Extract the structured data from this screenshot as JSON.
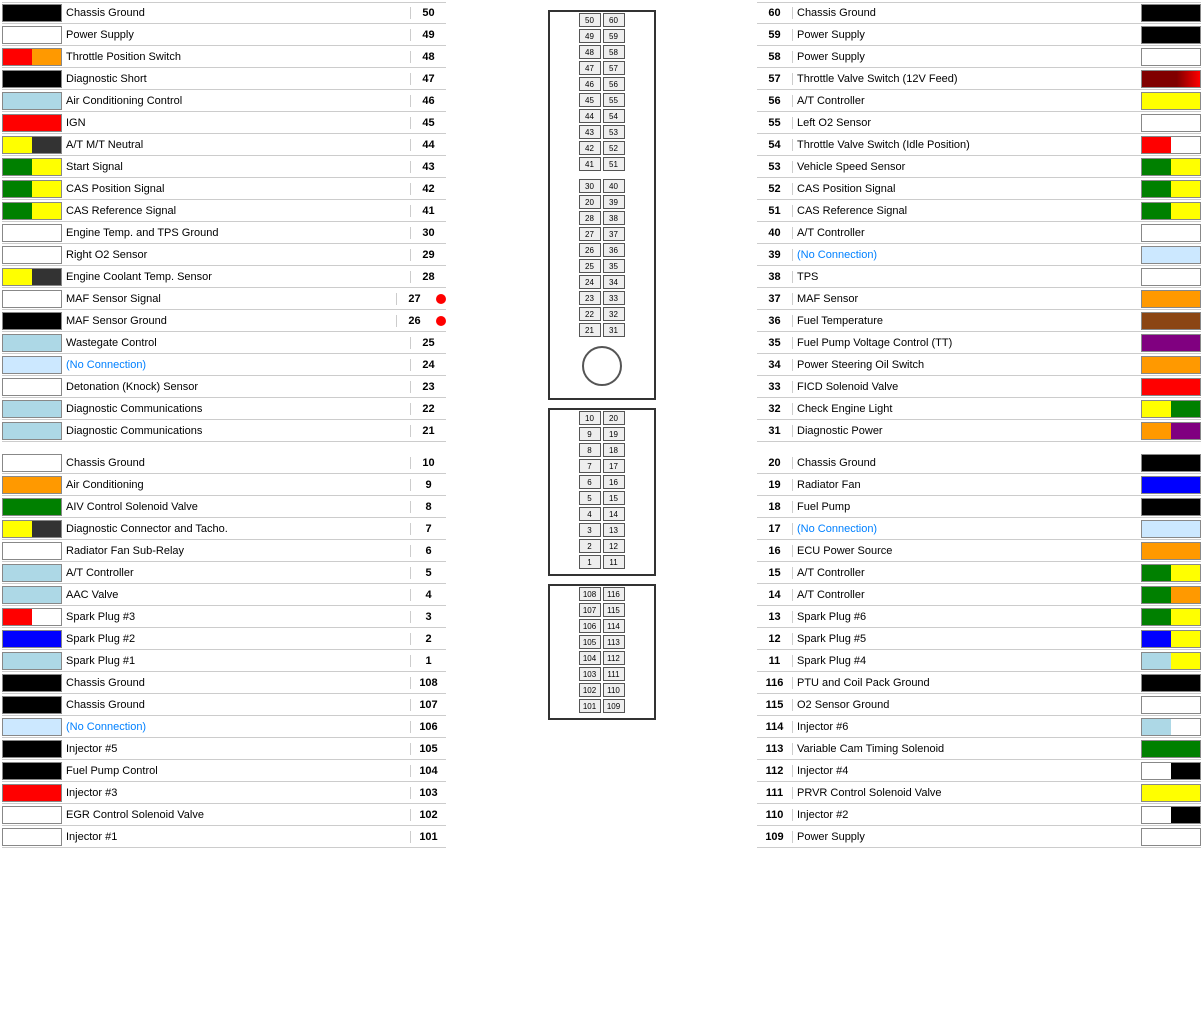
{
  "left_pins": [
    {
      "num": 50,
      "label": "Chassis Ground",
      "color": "#000"
    },
    {
      "num": 49,
      "label": "Power Supply",
      "color": "#fff"
    },
    {
      "num": 48,
      "label": "Throttle Position Switch",
      "color": "linear-gradient(to right, #f00 50%, #f90 50%)"
    },
    {
      "num": 47,
      "label": "Diagnostic Short",
      "color": "#000"
    },
    {
      "num": 46,
      "label": "Air Conditioning Control",
      "color": "#add8e6"
    },
    {
      "num": 45,
      "label": "IGN",
      "color": "#f00"
    },
    {
      "num": 44,
      "label": "A/T M/T Neutral",
      "color": "linear-gradient(to right, #ff0 50%, #333 50%)"
    },
    {
      "num": 43,
      "label": "Start Signal",
      "color": "linear-gradient(to right, #008000 50%, #ff0 50%)"
    },
    {
      "num": 42,
      "label": "CAS Position Signal",
      "color": "linear-gradient(to right, #008000 50%, #ff0 50%)"
    },
    {
      "num": 41,
      "label": "CAS Reference Signal",
      "color": "linear-gradient(to right, #008000 50%, #ff0 50%)"
    },
    {
      "num": 30,
      "label": "Engine Temp. and TPS Ground",
      "color": "#fff"
    },
    {
      "num": 29,
      "label": "Right O2 Sensor",
      "color": "#fff"
    },
    {
      "num": 28,
      "label": "Engine Coolant Temp. Sensor",
      "color": "linear-gradient(to right, #ff0 50%, #333 50%)"
    },
    {
      "num": 27,
      "label": "MAF Sensor Signal",
      "color": "#fff",
      "dot": true
    },
    {
      "num": 26,
      "label": "MAF Sensor Ground",
      "color": "#000",
      "dot": true
    },
    {
      "num": 25,
      "label": "Wastegate Control",
      "color": "#add8e6"
    },
    {
      "num": 24,
      "label": "(No Connection)",
      "color": "#cce8ff",
      "noconn": true
    },
    {
      "num": 23,
      "label": "Detonation (Knock) Sensor",
      "color": "#fff"
    },
    {
      "num": 22,
      "label": "Diagnostic Communications",
      "color": "#add8e6"
    },
    {
      "num": 21,
      "label": "Diagnostic Communications",
      "color": "#add8e6"
    },
    {
      "spacer": true
    },
    {
      "num": 10,
      "label": "Chassis Ground",
      "color": "#fff"
    },
    {
      "num": 9,
      "label": "Air Conditioning",
      "color": "#f90"
    },
    {
      "num": 8,
      "label": "AIV Control Solenoid Valve",
      "color": "#008000"
    },
    {
      "num": 7,
      "label": "Diagnostic Connector and Tacho.",
      "color": "linear-gradient(to right, #ff0 50%, #333 50%)"
    },
    {
      "num": 6,
      "label": "Radiator Fan Sub-Relay",
      "color": "#fff"
    },
    {
      "num": 5,
      "label": "A/T Controller",
      "color": "#add8e6"
    },
    {
      "num": 4,
      "label": "AAC Valve",
      "color": "#add8e6"
    },
    {
      "num": 3,
      "label": "Spark Plug #3",
      "color": "linear-gradient(to right, #f00 50%, #fff 50%)"
    },
    {
      "num": 2,
      "label": "Spark Plug #2",
      "color": "#00f"
    },
    {
      "num": 1,
      "label": "Spark Plug #1",
      "color": "#add8e6"
    },
    {
      "num": 108,
      "label": "Chassis Ground",
      "color": "#000"
    },
    {
      "num": 107,
      "label": "Chassis Ground",
      "color": "#000"
    },
    {
      "num": 106,
      "label": "(No Connection)",
      "color": "#cce8ff",
      "noconn": true
    },
    {
      "num": 105,
      "label": "Injector #5",
      "color": "#000"
    },
    {
      "num": 104,
      "label": "Fuel Pump Control",
      "color": "#000"
    },
    {
      "num": 103,
      "label": "Injector #3",
      "color": "#f00"
    },
    {
      "num": 102,
      "label": "EGR Control Solenoid Valve",
      "color": "#fff"
    },
    {
      "num": 101,
      "label": "Injector #1",
      "color": "#fff"
    }
  ],
  "right_pins": [
    {
      "num": 60,
      "label": "Chassis Ground",
      "color": "#000"
    },
    {
      "num": 59,
      "label": "Power Supply",
      "color": "#000"
    },
    {
      "num": 58,
      "label": "Power Supply",
      "color": "#fff"
    },
    {
      "num": 57,
      "label": "Throttle Valve Switch (12V Feed)",
      "color": "linear-gradient(to right, #800000 60%, #f00 100%)"
    },
    {
      "num": 56,
      "label": "A/T Controller",
      "color": "#ff0"
    },
    {
      "num": 55,
      "label": "Left O2 Sensor",
      "color": "#fff"
    },
    {
      "num": 54,
      "label": "Throttle Valve Switch (Idle Position)",
      "color": "linear-gradient(to right, #f00 50%, #fff 50%)"
    },
    {
      "num": 53,
      "label": "Vehicle Speed Sensor",
      "color": "linear-gradient(to right, #008000 50%, #ff0 50%)"
    },
    {
      "num": 52,
      "label": "CAS Position Signal",
      "color": "linear-gradient(to right, #008000 50%, #ff0 50%)"
    },
    {
      "num": 51,
      "label": "CAS Reference Signal",
      "color": "linear-gradient(to right, #008000 50%, #ff0 50%)"
    },
    {
      "num": 40,
      "label": "A/T Controller",
      "color": "#fff"
    },
    {
      "num": 39,
      "label": "(No Connection)",
      "color": "#cce8ff",
      "noconn": true
    },
    {
      "num": 38,
      "label": "TPS",
      "color": "#fff"
    },
    {
      "num": 37,
      "label": "MAF Sensor",
      "color": "#f90"
    },
    {
      "num": 36,
      "label": "Fuel Temperature",
      "color": "#8B4513"
    },
    {
      "num": 35,
      "label": "Fuel Pump Voltage Control (TT)",
      "color": "#800080"
    },
    {
      "num": 34,
      "label": "Power Steering Oil Switch",
      "color": "#f90"
    },
    {
      "num": 33,
      "label": "FICD Solenoid Valve",
      "color": "#f00"
    },
    {
      "num": 32,
      "label": "Check Engine Light",
      "color": "linear-gradient(to right, #ff0 50%, #008000 50%)"
    },
    {
      "num": 31,
      "label": "Diagnostic Power",
      "color": "linear-gradient(to right, #f90 50%, #800080 50%)"
    },
    {
      "spacer": true
    },
    {
      "num": 20,
      "label": "Chassis Ground",
      "color": "#000"
    },
    {
      "num": 19,
      "label": "Radiator Fan",
      "color": "#00f"
    },
    {
      "num": 18,
      "label": "Fuel Pump",
      "color": "#000"
    },
    {
      "num": 17,
      "label": "(No Connection)",
      "color": "#cce8ff",
      "noconn": true
    },
    {
      "num": 16,
      "label": "ECU Power Source",
      "color": "#f90"
    },
    {
      "num": 15,
      "label": "A/T Controller",
      "color": "linear-gradient(to right, #008000 50%, #ff0 50%)"
    },
    {
      "num": 14,
      "label": "A/T Controller",
      "color": "linear-gradient(to right, #008000 50%, #f90 50%)"
    },
    {
      "num": 13,
      "label": "Spark Plug #6",
      "color": "linear-gradient(to right, #008000 50%, #ff0 50%)"
    },
    {
      "num": 12,
      "label": "Spark Plug #5",
      "color": "linear-gradient(to right, #00f 50%, #ff0 50%)"
    },
    {
      "num": 11,
      "label": "Spark Plug #4",
      "color": "linear-gradient(to right, #add8e6 50%, #ff0 50%)"
    },
    {
      "num": 116,
      "label": "PTU and Coil Pack Ground",
      "color": "#000"
    },
    {
      "num": 115,
      "label": "O2 Sensor Ground",
      "color": "#fff"
    },
    {
      "num": 114,
      "label": "Injector #6",
      "color": "linear-gradient(to right, #add8e6 50%, #fff 50%)"
    },
    {
      "num": 113,
      "label": "Variable Cam Timing Solenoid",
      "color": "#008000"
    },
    {
      "num": 112,
      "label": "Injector #4",
      "color": "linear-gradient(to right, #fff 50%, #000 50%)"
    },
    {
      "num": 111,
      "label": "PRVR Control Solenoid Valve",
      "color": "#ff0"
    },
    {
      "num": 110,
      "label": "Injector #2",
      "color": "linear-gradient(to right, #fff 50%, #000 50%)"
    },
    {
      "num": 109,
      "label": "Power Supply",
      "color": "#fff"
    }
  ],
  "connector": {
    "top_rows": [
      [
        50,
        60
      ],
      [
        49,
        59
      ],
      [
        48,
        58
      ],
      [
        47,
        57
      ],
      [
        46,
        56
      ],
      [
        45,
        55
      ],
      [
        44,
        54
      ],
      [
        43,
        53
      ],
      [
        42,
        52
      ],
      [
        41,
        51
      ]
    ],
    "mid_rows": [
      [
        30,
        40
      ],
      [
        20,
        39
      ],
      [
        28,
        38
      ],
      [
        27,
        37
      ],
      [
        26,
        36
      ],
      [
        25,
        35
      ],
      [
        24,
        34
      ],
      [
        23,
        33
      ],
      [
        22,
        32
      ],
      [
        21,
        31
      ]
    ],
    "bot_rows": [
      [
        10,
        20
      ],
      [
        9,
        19
      ],
      [
        8,
        18
      ],
      [
        7,
        17
      ],
      [
        6,
        16
      ],
      [
        5,
        15
      ],
      [
        4,
        14
      ],
      [
        3,
        13
      ],
      [
        2,
        12
      ],
      [
        1,
        11
      ]
    ],
    "ext_rows": [
      [
        108,
        116
      ],
      [
        107,
        115
      ],
      [
        106,
        114
      ],
      [
        105,
        113
      ],
      [
        104,
        112
      ],
      [
        103,
        111
      ],
      [
        102,
        110
      ],
      [
        101,
        109
      ]
    ]
  }
}
